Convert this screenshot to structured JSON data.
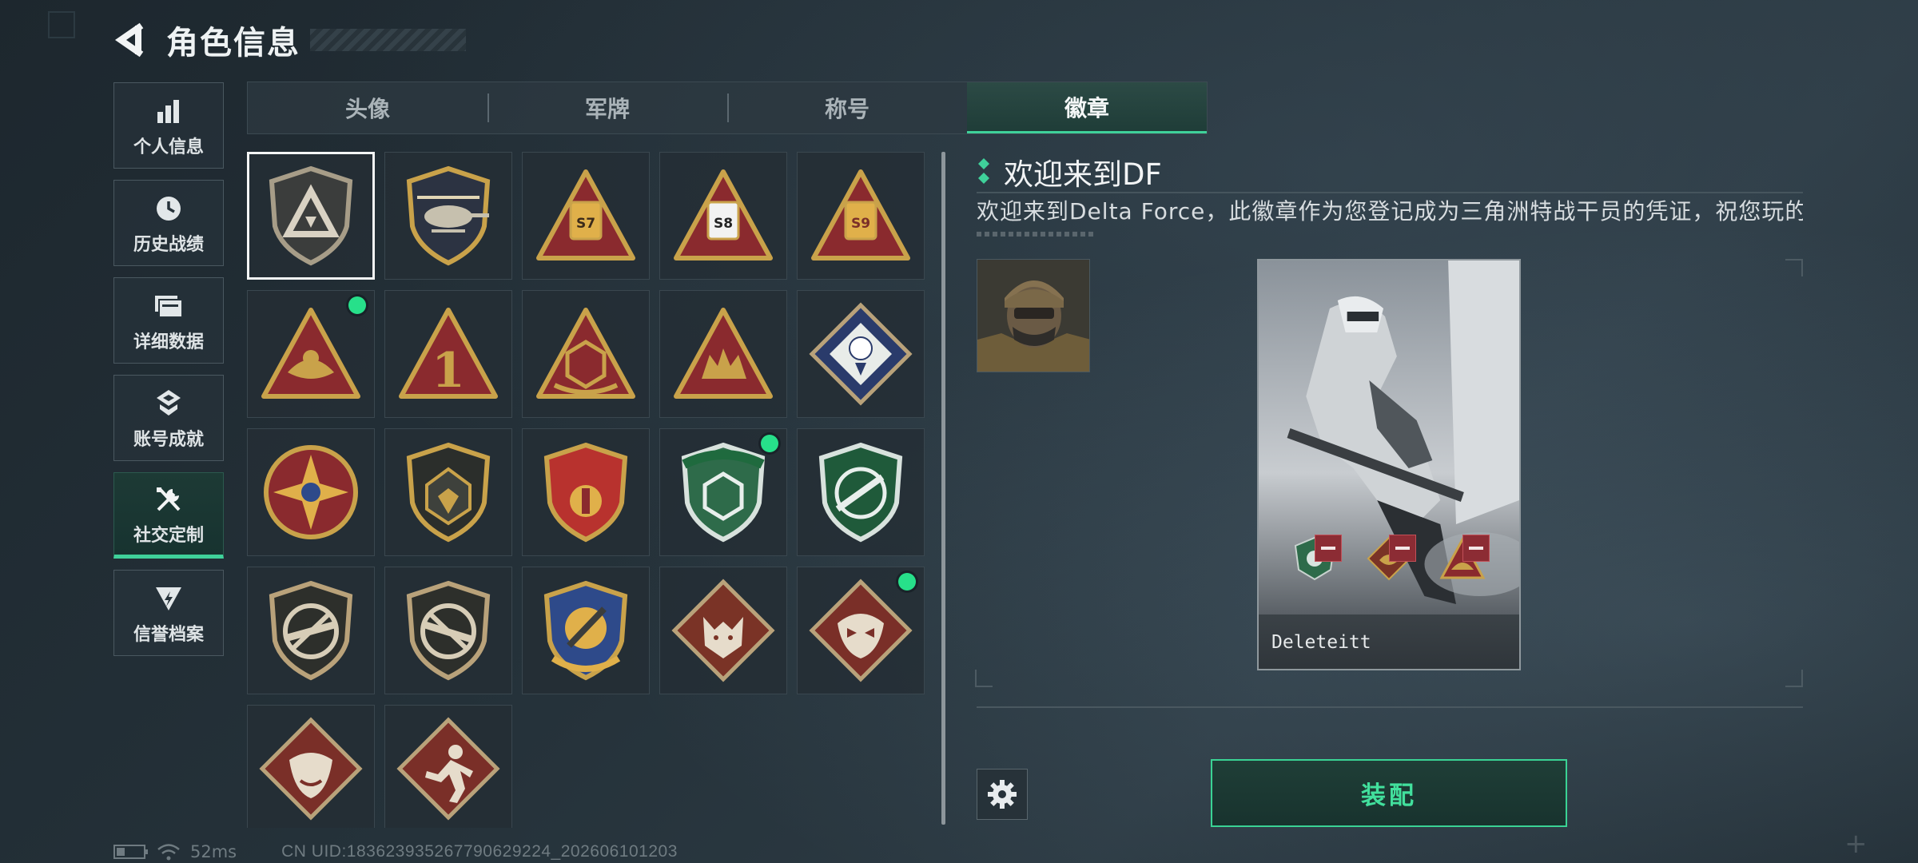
{
  "header": {
    "title": "角色信息"
  },
  "nav": [
    {
      "label": "个人信息",
      "icon": "bar-chart-icon"
    },
    {
      "label": "历史战绩",
      "icon": "clock-icon"
    },
    {
      "label": "详细数据",
      "icon": "folder-icon"
    },
    {
      "label": "账号成就",
      "icon": "achievement-icon"
    },
    {
      "label": "社交定制",
      "icon": "tools-icon",
      "active": true
    },
    {
      "label": "信誉档案",
      "icon": "credit-icon"
    }
  ],
  "tabs": [
    {
      "label": "头像"
    },
    {
      "label": "军牌"
    },
    {
      "label": "称号"
    },
    {
      "label": "徽章",
      "active": true
    }
  ],
  "badges": [
    {
      "icon": "delta-shield-badge-icon",
      "selected": true
    },
    {
      "icon": "helicopter-badge-icon"
    },
    {
      "icon": "s7-badge-icon",
      "text": "S7"
    },
    {
      "icon": "s8-badge-icon",
      "text": "S8"
    },
    {
      "icon": "s9-badge-icon",
      "text": "S9"
    },
    {
      "icon": "bowl-triangle-badge-icon",
      "new": true
    },
    {
      "icon": "number-one-badge-icon",
      "text": "1"
    },
    {
      "icon": "dice-triangle-badge-icon"
    },
    {
      "icon": "soldiers-triangle-badge-icon"
    },
    {
      "icon": "rose-diamond-badge-icon"
    },
    {
      "icon": "star-compass-badge-icon"
    },
    {
      "icon": "dark-shield-badge-icon"
    },
    {
      "icon": "blue-crest-badge-icon"
    },
    {
      "icon": "green-gem-shield-badge-icon",
      "new": true
    },
    {
      "icon": "green-rifle-shield-badge-icon"
    },
    {
      "icon": "no-rifle-shield-badge-icon"
    },
    {
      "icon": "no-rifle-shield-2-badge-icon"
    },
    {
      "icon": "blue-knife-crest-badge-icon"
    },
    {
      "icon": "wolf-diamond-badge-icon"
    },
    {
      "icon": "dragon-diamond-badge-icon",
      "new": true
    },
    {
      "icon": "dragon-diamond-2-badge-icon"
    },
    {
      "icon": "runner-diamond-badge-icon"
    }
  ],
  "detail": {
    "name": "欢迎来到DF",
    "description": "欢迎来到Delta Force，此徽章作为您登记成为三角洲特战干员的凭证，祝您玩的愉"
  },
  "card": {
    "player_name": "Deleteitt"
  },
  "actions": {
    "equip_label": "装配"
  },
  "status": {
    "ping": "52ms",
    "uid": "CN UID:1836239352677906292​24_202606101203"
  },
  "colors": {
    "accent": "#3fd19a",
    "badge_gold": "#c9a24a",
    "badge_red": "#8a2a2e",
    "badge_green": "#2e6b4a",
    "badge_blue": "#2e4a8a"
  }
}
